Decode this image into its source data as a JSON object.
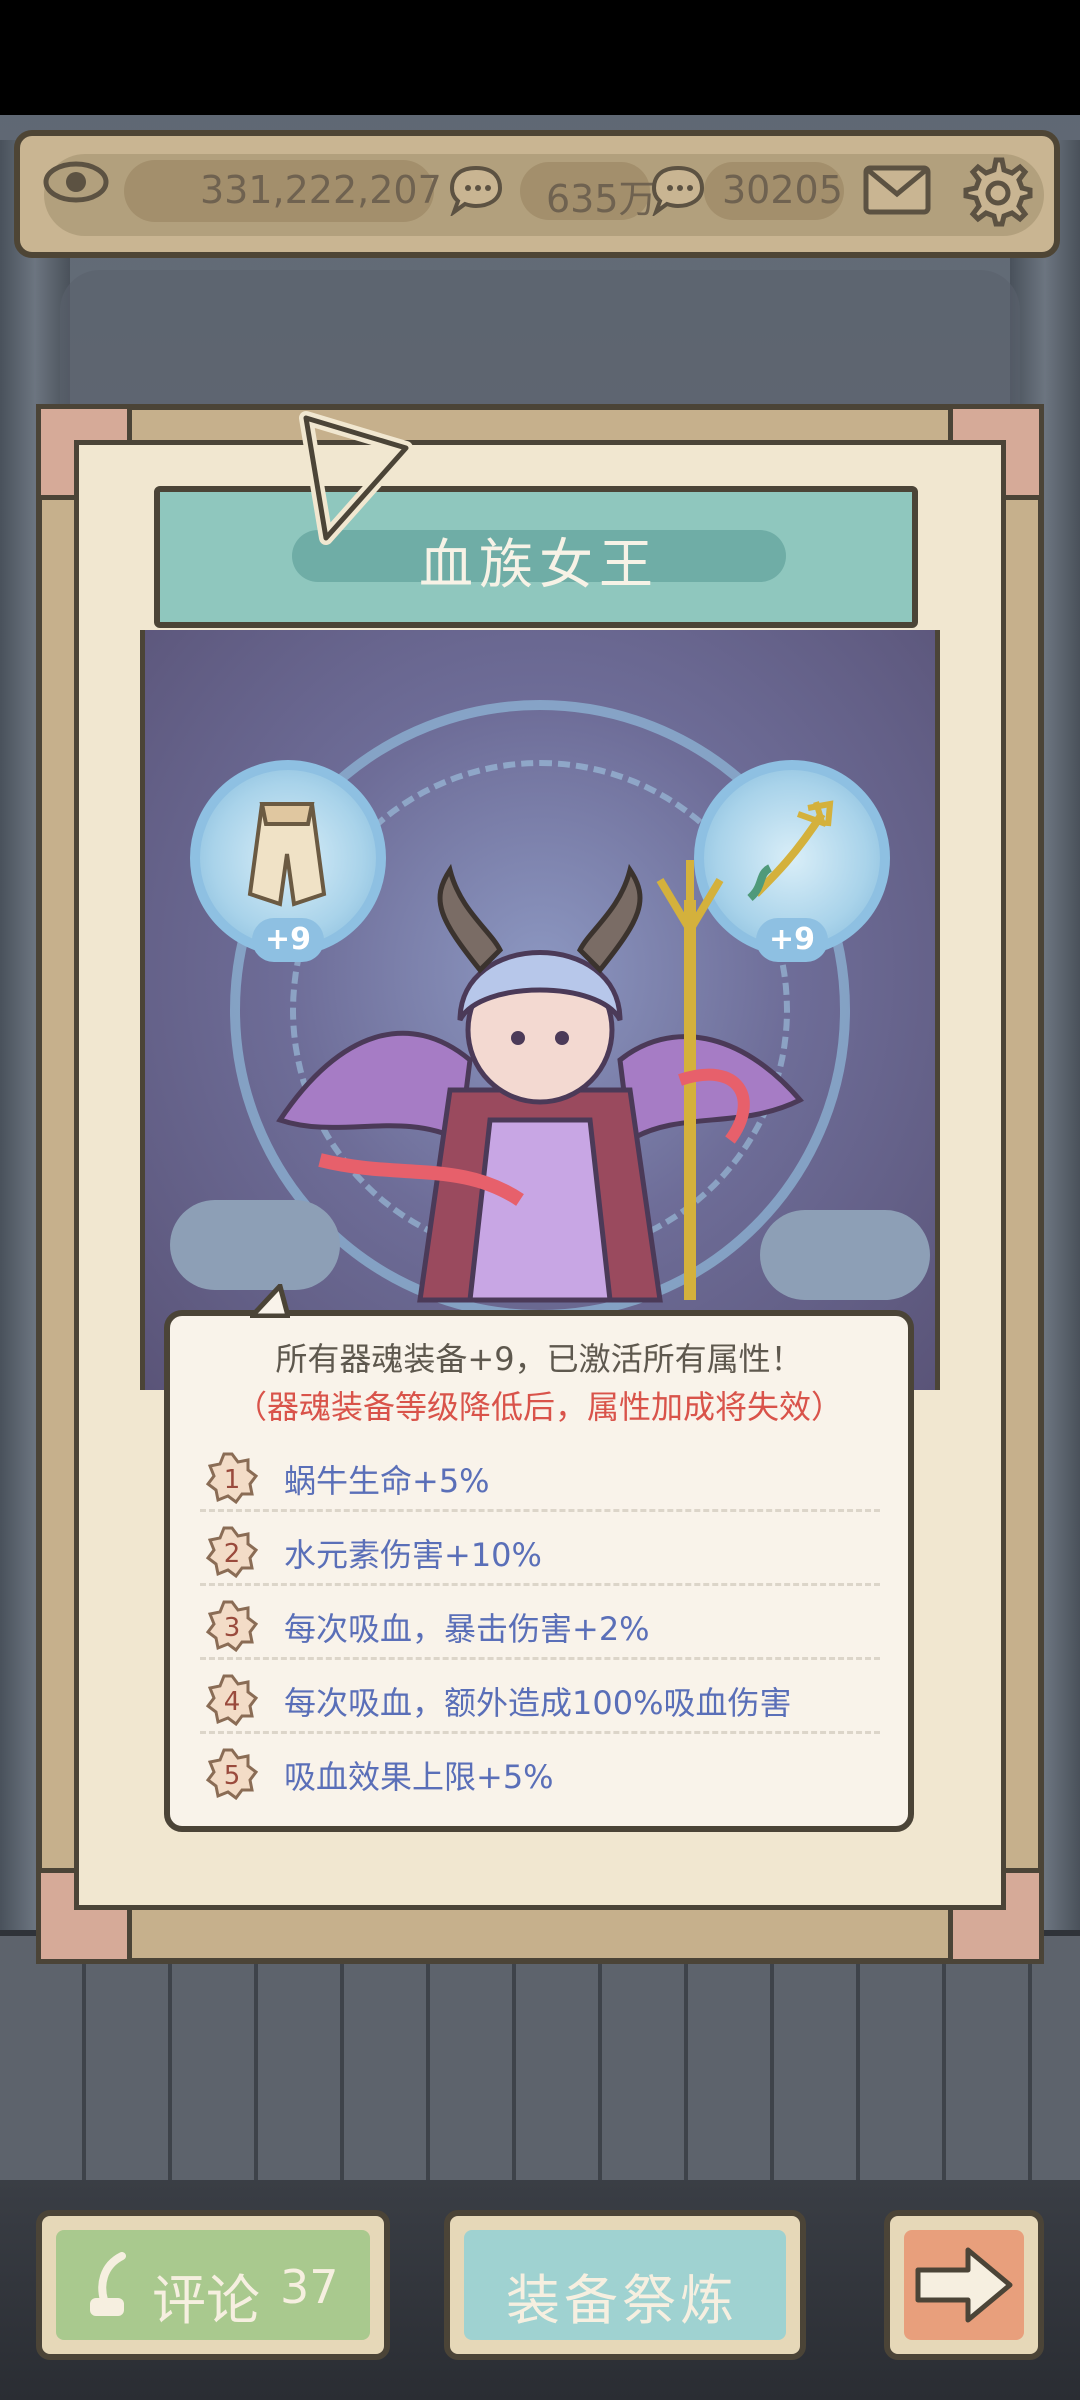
{
  "topbar": {
    "views": "331,222,207",
    "comments_count": "635万",
    "replies_count": "30205"
  },
  "card": {
    "title": "血族女王",
    "equip_left_level": "+9",
    "equip_right_level": "+9"
  },
  "info": {
    "line1": "所有器魂装备+9，已激活所有属性！",
    "line2": "（器魂装备等级降低后，属性加成将失效）",
    "attributes": [
      {
        "num": "1",
        "text": "蜗牛生命+5%"
      },
      {
        "num": "2",
        "text": "水元素伤害+10%"
      },
      {
        "num": "3",
        "text": "每次吸血，暴击伤害+2%"
      },
      {
        "num": "4",
        "text": "每次吸血，额外造成100%吸血伤害"
      },
      {
        "num": "5",
        "text": "吸血效果上限+5%"
      }
    ]
  },
  "buttons": {
    "comment_label": "评论",
    "comment_count": "37",
    "refine_label": "装备祭炼"
  },
  "colors": {
    "accent_teal": "#8fc7be",
    "attribute_text": "#5a6fb8",
    "warning_text": "#d9534a",
    "frame": "#4b4437"
  }
}
